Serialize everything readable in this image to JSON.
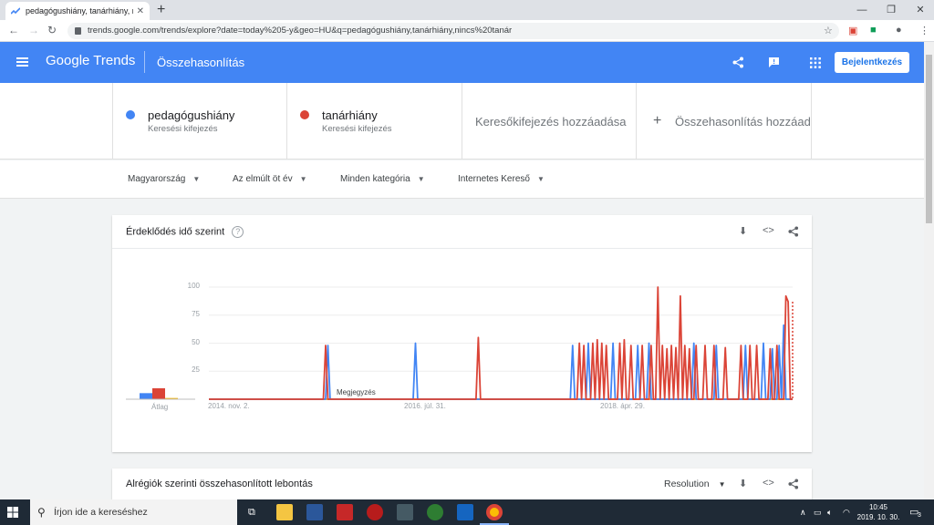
{
  "browser": {
    "tab_title": "pedagógushiány, tanárhiány, nincs",
    "url": "trends.google.com/trends/explore?date=today%205-y&geo=HU&q=pedagógushiány,tanárhiány,nincs%20tanár"
  },
  "header": {
    "logo_google": "Google",
    "logo_trends": "Trends",
    "page_title": "Összehasonlítás",
    "signin_label": "Bejelentkezés"
  },
  "terms": [
    {
      "name": "pedagógushiány",
      "sub": "Keresési kifejezés",
      "color": "#4285f4"
    },
    {
      "name": "tanárhiány",
      "sub": "Keresési kifejezés",
      "color": "#db4437"
    }
  ],
  "add_term_placeholder": "Keresőkifejezés hozzáadása",
  "add_compare_label": "Összehasonlítás hozzáadása",
  "filters": {
    "region": "Magyarország",
    "time": "Az elmúlt öt év",
    "category": "Minden kategória",
    "source": "Internetes Kereső"
  },
  "interest_card": {
    "title": "Érdeklődés idő szerint",
    "avg_label": "Átlag",
    "note_label": "Megjegyzés"
  },
  "chart_data": {
    "type": "line",
    "x_ticks": [
      "2014. nov. 2.",
      "2016. júl. 31.",
      "2018. ápr. 29."
    ],
    "y_ticks": [
      "100",
      "75",
      "50",
      "25"
    ],
    "ylim": [
      0,
      100
    ],
    "n_points": 261,
    "average": [
      {
        "name": "pedagógushiány",
        "value": 5,
        "color": "#4285f4"
      },
      {
        "name": "tanárhiány",
        "value": 9,
        "color": "#db4437"
      },
      {
        "name": "nincs tanár",
        "value": 1,
        "color": "#f4b400"
      }
    ],
    "series": [
      {
        "name": "pedagógushiány",
        "color": "#4285f4",
        "points": [
          [
            53,
            48
          ],
          [
            92,
            50
          ],
          [
            162,
            48
          ],
          [
            169,
            50
          ],
          [
            180,
            50
          ],
          [
            191,
            48
          ],
          [
            196,
            50
          ],
          [
            216,
            50
          ],
          [
            226,
            48
          ],
          [
            239,
            48
          ],
          [
            247,
            50
          ],
          [
            251,
            45
          ],
          [
            254,
            48
          ],
          [
            256,
            66
          ]
        ]
      },
      {
        "name": "tanárhiány",
        "color": "#db4437",
        "points": [
          [
            52,
            48
          ],
          [
            120,
            55
          ],
          [
            165,
            50
          ],
          [
            167,
            48
          ],
          [
            171,
            50
          ],
          [
            173,
            53
          ],
          [
            175,
            50
          ],
          [
            177,
            48
          ],
          [
            183,
            50
          ],
          [
            185,
            53
          ],
          [
            188,
            48
          ],
          [
            193,
            48
          ],
          [
            197,
            48
          ],
          [
            200,
            100
          ],
          [
            202,
            48
          ],
          [
            204,
            45
          ],
          [
            206,
            48
          ],
          [
            208,
            46
          ],
          [
            210,
            92
          ],
          [
            212,
            48
          ],
          [
            214,
            45
          ],
          [
            217,
            48
          ],
          [
            221,
            48
          ],
          [
            225,
            48
          ],
          [
            230,
            46
          ],
          [
            237,
            48
          ],
          [
            241,
            48
          ],
          [
            244,
            48
          ],
          [
            250,
            45
          ],
          [
            253,
            48
          ],
          [
            257,
            92
          ],
          [
            258,
            87
          ]
        ]
      },
      {
        "name": "nincs tanár",
        "color": "#f4b400",
        "points": []
      }
    ]
  },
  "subregion_card": {
    "title": "Alrégiók szerinti összehasonlított lebontás",
    "resolution_label": "Resolution"
  },
  "taskbar": {
    "search_placeholder": "Írjon ide a kereséshez",
    "time": "10:45",
    "date": "2019. 10. 30.",
    "notification_count": "3"
  }
}
